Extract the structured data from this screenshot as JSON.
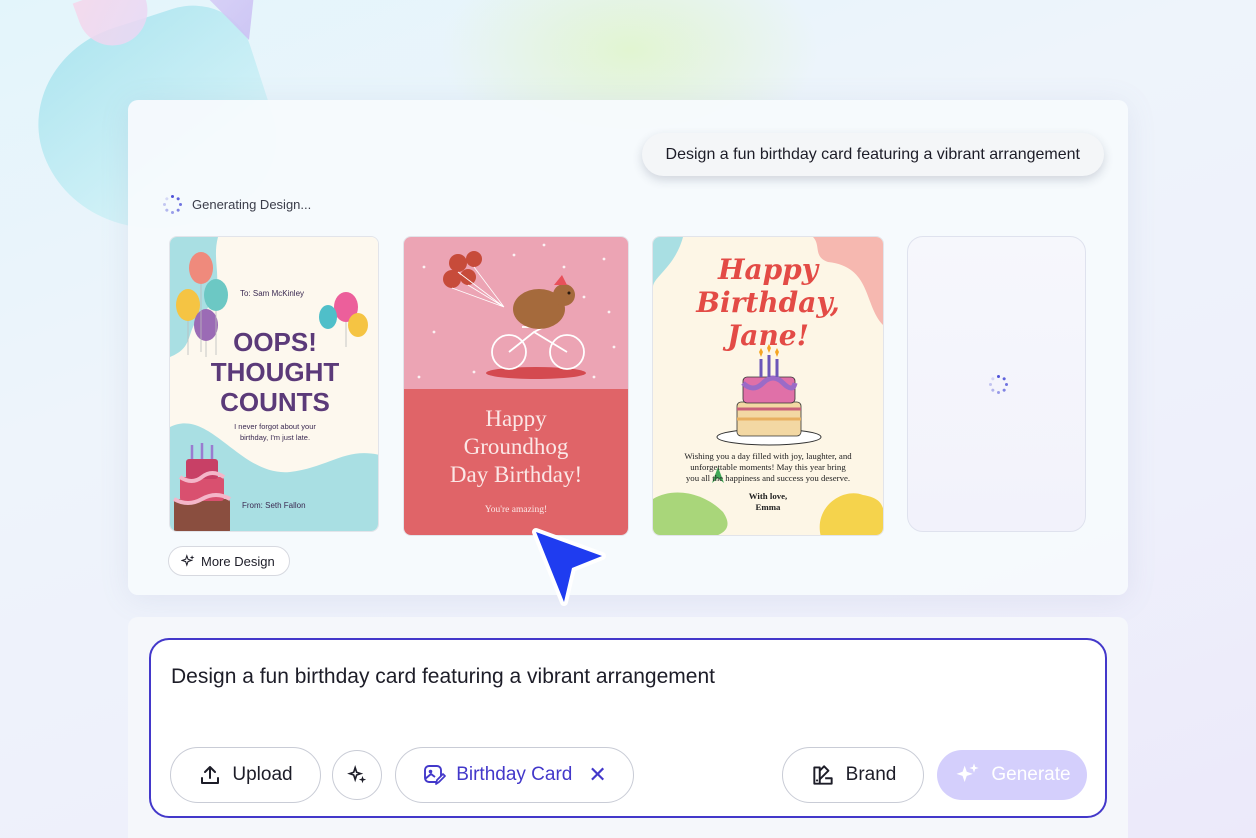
{
  "chat": {
    "prompt": "Design a fun birthday card featuring a vibrant arrangement",
    "status": "Generating Design...",
    "more_button": "More Design"
  },
  "cards": [
    {
      "to": "To: Sam McKinley",
      "headline": [
        "OOPS!",
        "THOUGHT",
        "COUNTS"
      ],
      "message": [
        "I never forgot about your",
        "birthday, I'm just late."
      ],
      "from": "From: Seth Fallon"
    },
    {
      "headline": [
        "Happy",
        "Groundhog",
        "Day Birthday!"
      ],
      "subtext": "You're amazing!"
    },
    {
      "headline": [
        "Happy",
        "Birthday,",
        "Jane!"
      ],
      "message": [
        "Wishing you a day filled with joy, laughter, and",
        "unforgettable moments! May this year bring",
        "you all the happiness and success you deserve."
      ],
      "signoff": [
        "With love,",
        "Emma"
      ]
    }
  ],
  "composer": {
    "text": "Design a fun birthday card featuring a vibrant arrangement",
    "upload": "Upload",
    "tag": "Birthday Card",
    "tag_close": "✕",
    "brand": "Brand",
    "generate": "Generate"
  },
  "colors": {
    "accent": "#4338ca",
    "generate_disabled": "#d4cffc",
    "card2_top": "#eca4b4",
    "card2_bottom": "#e06468"
  },
  "icons": [
    "spinner-icon",
    "sparkle-icon",
    "upload-icon",
    "magic-wand-icon",
    "image-edit-icon",
    "close-icon",
    "brand-icon",
    "cursor-arrow-icon"
  ]
}
